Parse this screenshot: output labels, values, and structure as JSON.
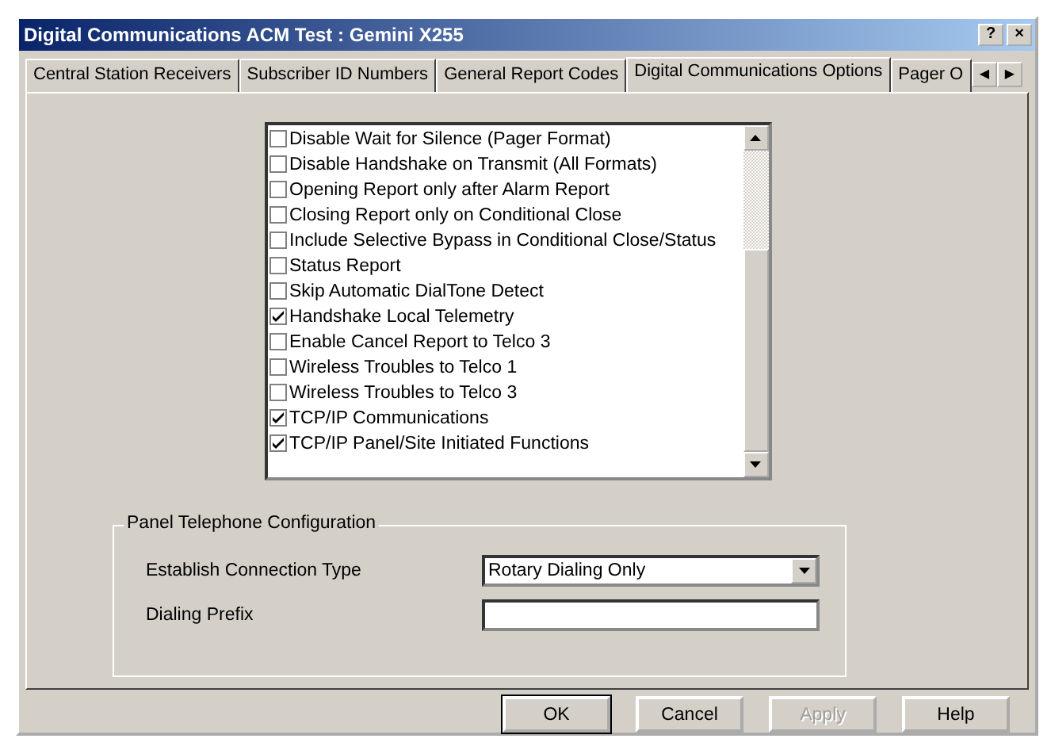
{
  "window": {
    "title": "Digital Communications ACM Test : Gemini X255",
    "title_buttons": [
      "?",
      "×"
    ]
  },
  "tabs": [
    {
      "label": "Central Station Receivers",
      "selected": false
    },
    {
      "label": "Subscriber ID Numbers",
      "selected": false
    },
    {
      "label": "General Report Codes",
      "selected": false
    },
    {
      "label": "Digital Communications Options",
      "selected": true
    },
    {
      "label": "Pager O",
      "selected": false
    }
  ],
  "tab_scroll": [
    "◀",
    "▶"
  ],
  "options": [
    {
      "label": "Disable Wait for Silence (Pager Format)",
      "checked": false
    },
    {
      "label": "Disable Handshake on Transmit (All Formats)",
      "checked": false
    },
    {
      "label": "Opening Report only after Alarm Report",
      "checked": false
    },
    {
      "label": "Closing Report only on Conditional Close",
      "checked": false
    },
    {
      "label": "Include Selective Bypass in Conditional Close/Status",
      "checked": false
    },
    {
      "label": "Status Report",
      "checked": false
    },
    {
      "label": "Skip Automatic DialTone Detect",
      "checked": false
    },
    {
      "label": "Handshake Local Telemetry",
      "checked": true
    },
    {
      "label": "Enable Cancel Report to Telco 3",
      "checked": false
    },
    {
      "label": "Wireless Troubles to Telco 1",
      "checked": false
    },
    {
      "label": "Wireless Troubles to Telco 3",
      "checked": false
    },
    {
      "label": "TCP/IP Communications",
      "checked": true
    },
    {
      "label": "TCP/IP Panel/Site Initiated Functions",
      "checked": true
    }
  ],
  "panel_telephone": {
    "title": "Panel Telephone Configuration",
    "fields": [
      {
        "kind": "dropdown",
        "label": "Establish Connection Type",
        "value": "Rotary Dialing Only"
      },
      {
        "kind": "text",
        "label": "Dialing Prefix"
      }
    ]
  },
  "buttons": [
    {
      "label": "OK",
      "disabled": false
    },
    {
      "label": "Cancel",
      "disabled": false
    },
    {
      "label": "Apply",
      "disabled": true
    },
    {
      "label": "Help",
      "disabled": false
    }
  ]
}
